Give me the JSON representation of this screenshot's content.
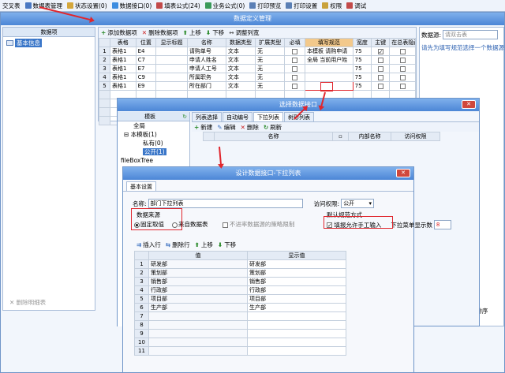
{
  "toolbar": [
    "交叉表",
    "数据表管理",
    "状态设置(0)",
    "数据接口(0)",
    "填表公式(24)",
    "业务公式(0)",
    "打印预览",
    "打印设置",
    "权限",
    "调试"
  ],
  "main": {
    "title": "数据定义管理",
    "left_header": "数据项",
    "tree_root": "基本信息",
    "left_footer": "删除明细表",
    "buttons": [
      "添加数据项",
      "删除数据项",
      "上移",
      "下移",
      "调整列宽"
    ],
    "columns": [
      "表格",
      "位置",
      "显示标题",
      "名称",
      "数据类型",
      "扩展类型",
      "必填",
      "填写规范",
      "宽度",
      "主键",
      "在总表隐藏"
    ],
    "rows": [
      {
        "n": "1",
        "t": "表格1",
        "p": "E4",
        "title": "",
        "name": "请购单号",
        "type": "文本",
        "ext": "无",
        "req": false,
        "spec": "本模板 请购申请",
        "w": "75",
        "pk": true,
        "hide": false
      },
      {
        "n": "2",
        "t": "表格1",
        "p": "C7",
        "title": "",
        "name": "申请人姓名",
        "type": "文本",
        "ext": "无",
        "req": false,
        "spec": "全局 当前用户姓",
        "w": "75",
        "pk": false,
        "hide": false
      },
      {
        "n": "3",
        "t": "表格1",
        "p": "E7",
        "title": "",
        "name": "申请人工号",
        "type": "文本",
        "ext": "无",
        "req": false,
        "spec": "",
        "w": "75",
        "pk": false,
        "hide": false
      },
      {
        "n": "4",
        "t": "表格1",
        "p": "C9",
        "title": "",
        "name": "所属职务",
        "type": "文本",
        "ext": "无",
        "req": false,
        "spec": "",
        "w": "75",
        "pk": false,
        "hide": false
      },
      {
        "n": "5",
        "t": "表格1",
        "p": "E9",
        "title": "",
        "name": "所在部门",
        "type": "文本",
        "ext": "无",
        "req": false,
        "spec": "",
        "w": "75",
        "pk": false,
        "hide": false
      }
    ],
    "right_label": "数据源:",
    "right_placeholder": "请双击表",
    "right_hint": "请先为填写规范选择一个数据源!",
    "right_stub": "(形形及排序"
  },
  "select": {
    "title": "选择数据接口",
    "left_header": "模板",
    "tree": [
      "全局",
      "本模板(1)",
      "私有(0)",
      "公开(1)",
      "fileBoxTree"
    ],
    "tabs": [
      "列表选择",
      "自动编号",
      "下拉列表",
      "树形列表"
    ],
    "buttons": [
      "新建",
      "编辑",
      "删除",
      "刷新"
    ],
    "columns": [
      "名称",
      "内部名称",
      "访问权限"
    ]
  },
  "dialog": {
    "title": "设计数据接口-下拉列表",
    "tab": "基本设置",
    "name_label": "名称:",
    "name_value": "部门下拉列表",
    "access_label": "访问权限:",
    "access_value": "公开",
    "source_label": "数据来源",
    "source_fixed": "固定取值",
    "source_table": "来自数据表",
    "no_limit": "不进率数据源的策略限制",
    "default_label": "默认规范方式",
    "allow_manual": "填报允许手工输入",
    "menu_count_label": "下拉菜单显示数",
    "menu_count": "8",
    "buttons": [
      "插入行",
      "删除行",
      "上移",
      "下移"
    ],
    "columns": [
      "值",
      "显示值"
    ],
    "rows": [
      [
        "1",
        "研发部",
        "研发部"
      ],
      [
        "2",
        "策划部",
        "策划部"
      ],
      [
        "3",
        "销售部",
        "销售部"
      ],
      [
        "4",
        "行政部",
        "行政部"
      ],
      [
        "5",
        "项目部",
        "项目部"
      ],
      [
        "6",
        "生产部",
        "生产部"
      ],
      [
        "7",
        "",
        ""
      ],
      [
        "8",
        "",
        ""
      ],
      [
        "9",
        "",
        ""
      ],
      [
        "10",
        "",
        ""
      ],
      [
        "11",
        "",
        ""
      ]
    ]
  },
  "colors": {
    "accent": "#e0262d",
    "title": "#4c86d6"
  }
}
